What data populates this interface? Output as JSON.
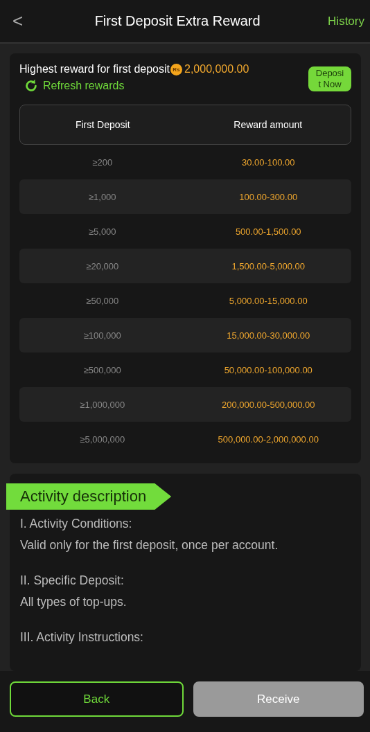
{
  "header": {
    "back": "<",
    "title": "First Deposit Extra Reward",
    "history": "History"
  },
  "reward": {
    "label": "Highest reward for first deposit",
    "currency": "Rs",
    "amount": "2,000,000.00",
    "refresh": "Refresh rewards",
    "deposit_button": "Deposi t Now"
  },
  "table": {
    "columns": [
      "First Deposit",
      "Reward amount"
    ],
    "rows": [
      [
        "≥200",
        "30.00-100.00"
      ],
      [
        "≥1,000",
        "100.00-300.00"
      ],
      [
        "≥5,000",
        "500.00-1,500.00"
      ],
      [
        "≥20,000",
        "1,500.00-5,000.00"
      ],
      [
        "≥50,000",
        "5,000.00-15,000.00"
      ],
      [
        "≥100,000",
        "15,000.00-30,000.00"
      ],
      [
        "≥500,000",
        "50,000.00-100,000.00"
      ],
      [
        "≥1,000,000",
        "200,000.00-500,000.00"
      ],
      [
        "≥5,000,000",
        "500,000.00-2,000,000.00"
      ]
    ]
  },
  "description": {
    "title": "Activity description",
    "paragraphs": [
      {
        "heading": "I. Activity Conditions:",
        "text": "Valid only for the first deposit, once per account."
      },
      {
        "heading": "II. Specific Deposit:",
        "text": "All types of top-ups."
      },
      {
        "heading": "III. Activity Instructions:"
      }
    ]
  },
  "footer": {
    "buttons": [
      {
        "label": "Back",
        "kind": "outline",
        "disabled": false
      },
      {
        "label": "Receive",
        "kind": "filled",
        "disabled": true
      }
    ]
  }
}
